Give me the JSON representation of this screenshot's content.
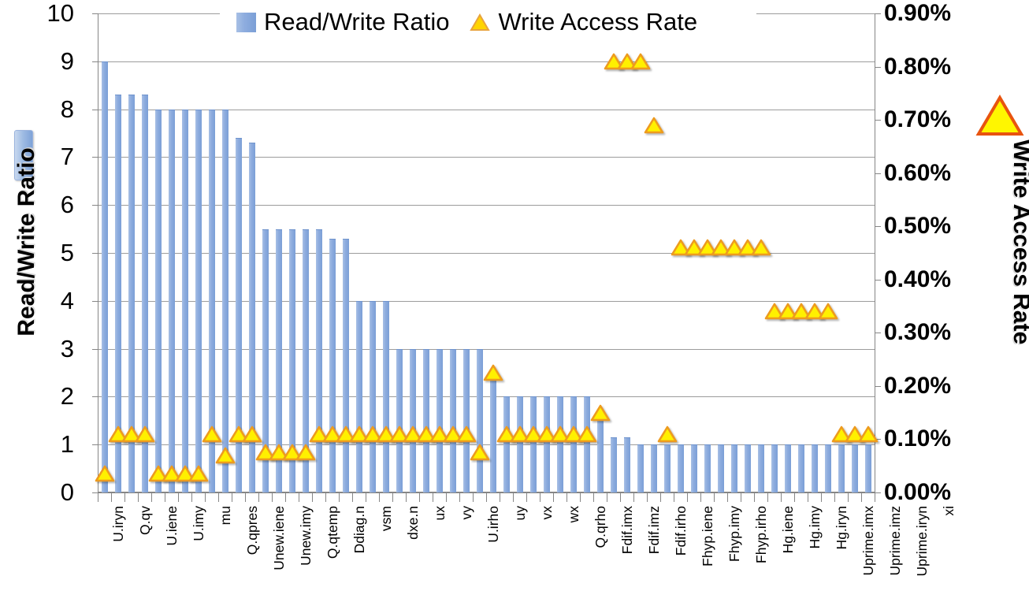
{
  "legend": {
    "items": [
      {
        "label": "Read/Write Ratio",
        "marker": "square-icon",
        "color": "#8EADDF"
      },
      {
        "label": "Write Access Rate",
        "marker": "triangle-icon",
        "color": "#FFFF00"
      }
    ]
  },
  "axes": {
    "left_title": "Read/Write Ratio",
    "right_title": "Write Access Rate"
  },
  "chart_data": {
    "type": "bar",
    "title": "",
    "subtitle": "",
    "xlabel": "",
    "ylabel": "Read/Write Ratio",
    "y2label": "Write Access Rate",
    "ylim": [
      0,
      10
    ],
    "y2lim": [
      0,
      0.9
    ],
    "ytick_labels": [
      "0",
      "1",
      "2",
      "3",
      "4",
      "5",
      "6",
      "7",
      "8",
      "9",
      "10"
    ],
    "ytick_values": [
      0,
      1,
      2,
      3,
      4,
      5,
      6,
      7,
      8,
      9,
      10
    ],
    "y2tick_labels": [
      "0.00%",
      "0.10%",
      "0.20%",
      "0.30%",
      "0.40%",
      "0.50%",
      "0.60%",
      "0.70%",
      "0.80%",
      "0.90%"
    ],
    "y2tick_values": [
      0,
      0.1,
      0.2,
      0.3,
      0.4,
      0.5,
      0.6,
      0.7,
      0.8,
      0.9
    ],
    "grid": true,
    "legend_position": "top",
    "categories": [
      "U.iryn",
      "",
      "Q.qv",
      "",
      "U.iene",
      "",
      "U.imy",
      "",
      "mu",
      "",
      "Q.qpres",
      "",
      "Unew.iene",
      "",
      "Unew.imy",
      "",
      "Q.qtemp",
      "",
      "Ddiag.n",
      "",
      "vsm",
      "",
      "dxe.n",
      "",
      "ux",
      "",
      "vy",
      "",
      "U.irho",
      "",
      "uy",
      "",
      "vx",
      "",
      "wx",
      "",
      "Q.qrho",
      "",
      "Fdif.imx",
      "",
      "Fdif.imz",
      "",
      "Fdif.irho",
      "",
      "Fhyp.iene",
      "",
      "Fhyp.imy",
      "",
      "Fhyp.irho",
      "",
      "Hg.iene",
      "",
      "Hg.imy",
      "",
      "Hg.iryn",
      "",
      "Uprime.imx",
      "",
      "Uprime.imz",
      "",
      "Uprime.iryn",
      "",
      "xi"
    ],
    "series": [
      {
        "name": "Read/Write Ratio",
        "axis": "left",
        "type": "bar",
        "color": "#8EADDF",
        "values": [
          9.0,
          8.3,
          8.3,
          8.3,
          8.0,
          8.0,
          8.0,
          8.0,
          8.0,
          8.0,
          7.4,
          7.3,
          5.5,
          5.5,
          5.5,
          5.5,
          5.5,
          5.3,
          5.3,
          4.0,
          4.0,
          4.0,
          3.0,
          3.0,
          3.0,
          3.0,
          3.0,
          3.0,
          3.0,
          2.5,
          2.0,
          2.0,
          2.0,
          2.0,
          2.0,
          2.0,
          2.0,
          1.7,
          1.15,
          1.15,
          1.0,
          1.0,
          1.0,
          1.0,
          1.0,
          1.0,
          1.0,
          1.0,
          1.0,
          1.0,
          1.0,
          1.0,
          1.0,
          1.0,
          1.0,
          1.0,
          1.0,
          1.0
        ]
      },
      {
        "name": "Write Access Rate",
        "axis": "right",
        "type": "scatter",
        "marker": "triangle",
        "color": "#FFFF00",
        "edge_color": "#ED9B1F",
        "values": [
          0.035,
          0.11,
          0.11,
          0.11,
          0.035,
          0.035,
          0.035,
          0.035,
          0.11,
          0.07,
          0.11,
          0.11,
          0.075,
          0.075,
          0.075,
          0.075,
          0.11,
          0.11,
          0.11,
          0.11,
          0.11,
          0.11,
          0.11,
          0.11,
          0.11,
          0.11,
          0.11,
          0.11,
          0.075,
          0.225,
          0.11,
          0.11,
          0.11,
          0.11,
          0.11,
          0.11,
          0.11,
          0.15,
          0.81,
          0.81,
          0.81,
          0.69,
          0.11,
          0.46,
          0.46,
          0.46,
          0.46,
          0.46,
          0.46,
          0.46,
          0.34,
          0.34,
          0.34,
          0.34,
          0.34,
          0.11,
          0.11,
          0.11
        ],
        "extra_points": [
          {
            "index": 55,
            "value": 0.11
          },
          {
            "index": 56,
            "value": 0.11
          },
          {
            "index": 57,
            "value": 0.11
          }
        ]
      }
    ]
  }
}
